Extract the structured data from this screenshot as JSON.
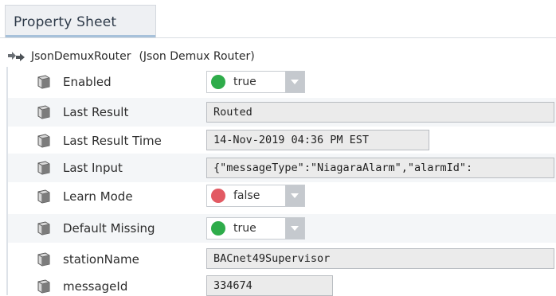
{
  "panel": {
    "tab_title": "Property Sheet"
  },
  "component": {
    "name": "JsonDemuxRouter",
    "type_label": "(Json Demux Router)",
    "icon": "router-icon"
  },
  "properties": [
    {
      "name": "Enabled",
      "kind": "select",
      "value": "true",
      "status_color": "#2eac4a",
      "icon": "slot-icon"
    },
    {
      "name": "Last Result",
      "kind": "text",
      "value": "Routed",
      "icon": "slot-icon"
    },
    {
      "name": "Last Result Time",
      "kind": "text",
      "value": "14-Nov-2019 04:36 PM EST",
      "icon": "slot-icon"
    },
    {
      "name": "Last Input",
      "kind": "text",
      "value": "{\"messageType\":\"NiagaraAlarm\",\"alarmId\":",
      "icon": "slot-icon"
    },
    {
      "name": "Learn Mode",
      "kind": "select",
      "value": "false",
      "status_color": "#e25a63",
      "icon": "slot-icon"
    },
    {
      "name": "Default Missing",
      "kind": "select",
      "value": "true",
      "status_color": "#2eac4a",
      "icon": "slot-icon"
    },
    {
      "name": "stationName",
      "kind": "text",
      "value": "BACnet49Supervisor",
      "icon": "slot-icon"
    },
    {
      "name": "messageId",
      "kind": "text",
      "value": "334674",
      "icon": "slot-icon"
    }
  ]
}
